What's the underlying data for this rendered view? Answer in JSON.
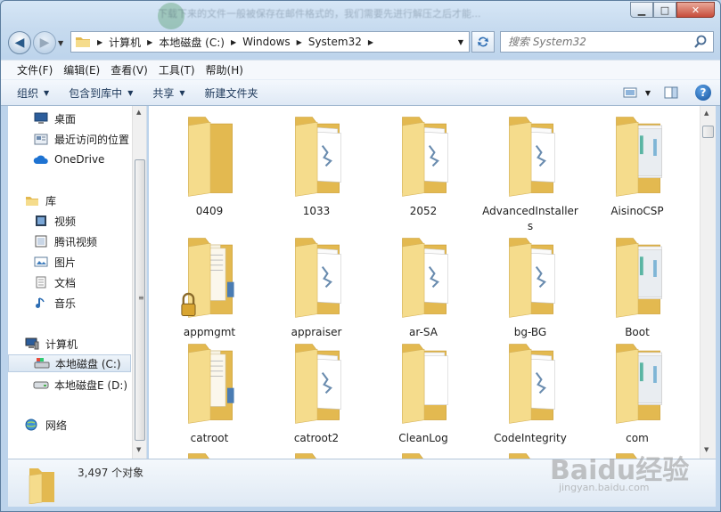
{
  "window": {
    "ghost_text": "下载下来的文件一般被保存在邮件格式的，我们需要先进行解压之后才能..."
  },
  "address": {
    "crumbs": [
      "计算机",
      "本地磁盘 (C:)",
      "Windows",
      "System32"
    ]
  },
  "search": {
    "placeholder": "搜索 System32"
  },
  "menu": [
    "文件(F)",
    "编辑(E)",
    "查看(V)",
    "工具(T)",
    "帮助(H)"
  ],
  "toolbar": {
    "organize": "组织",
    "include_library": "包含到库中",
    "share": "共享",
    "new_folder": "新建文件夹"
  },
  "navpane": {
    "desktop": "桌面",
    "recent": "最近访问的位置",
    "onedrive": "OneDrive",
    "libraries": "库",
    "videos": "视频",
    "tencent_video": "腾讯视频",
    "pictures": "图片",
    "documents": "文档",
    "music": "音乐",
    "computer": "计算机",
    "local_c": "本地磁盘 (C:)",
    "local_e": "本地磁盘E (D:)",
    "network": "网络"
  },
  "folders": [
    {
      "name": "0409",
      "type": "empty"
    },
    {
      "name": "1033",
      "type": "docs"
    },
    {
      "name": "2052",
      "type": "docs"
    },
    {
      "name": "AdvancedInstallers",
      "type": "docs"
    },
    {
      "name": "AisinoCSP",
      "type": "green"
    },
    {
      "name": "appmgmt",
      "type": "locked"
    },
    {
      "name": "appraiser",
      "type": "docs"
    },
    {
      "name": "ar-SA",
      "type": "docs"
    },
    {
      "name": "bg-BG",
      "type": "docs"
    },
    {
      "name": "Boot",
      "type": "green"
    },
    {
      "name": "catroot",
      "type": "lined"
    },
    {
      "name": "catroot2",
      "type": "docs"
    },
    {
      "name": "CleanLog",
      "type": "plain"
    },
    {
      "name": "CodeIntegrity",
      "type": "docs"
    },
    {
      "name": "com",
      "type": "green"
    }
  ],
  "details": {
    "count": "3,497 个对象"
  },
  "watermark": {
    "brand": "Baidu经验",
    "url": "jingyan.baidu.com"
  },
  "colors": {
    "folder_front": "#f5dc8c",
    "folder_back": "#e3b950",
    "selection": "#dbe7f3"
  }
}
